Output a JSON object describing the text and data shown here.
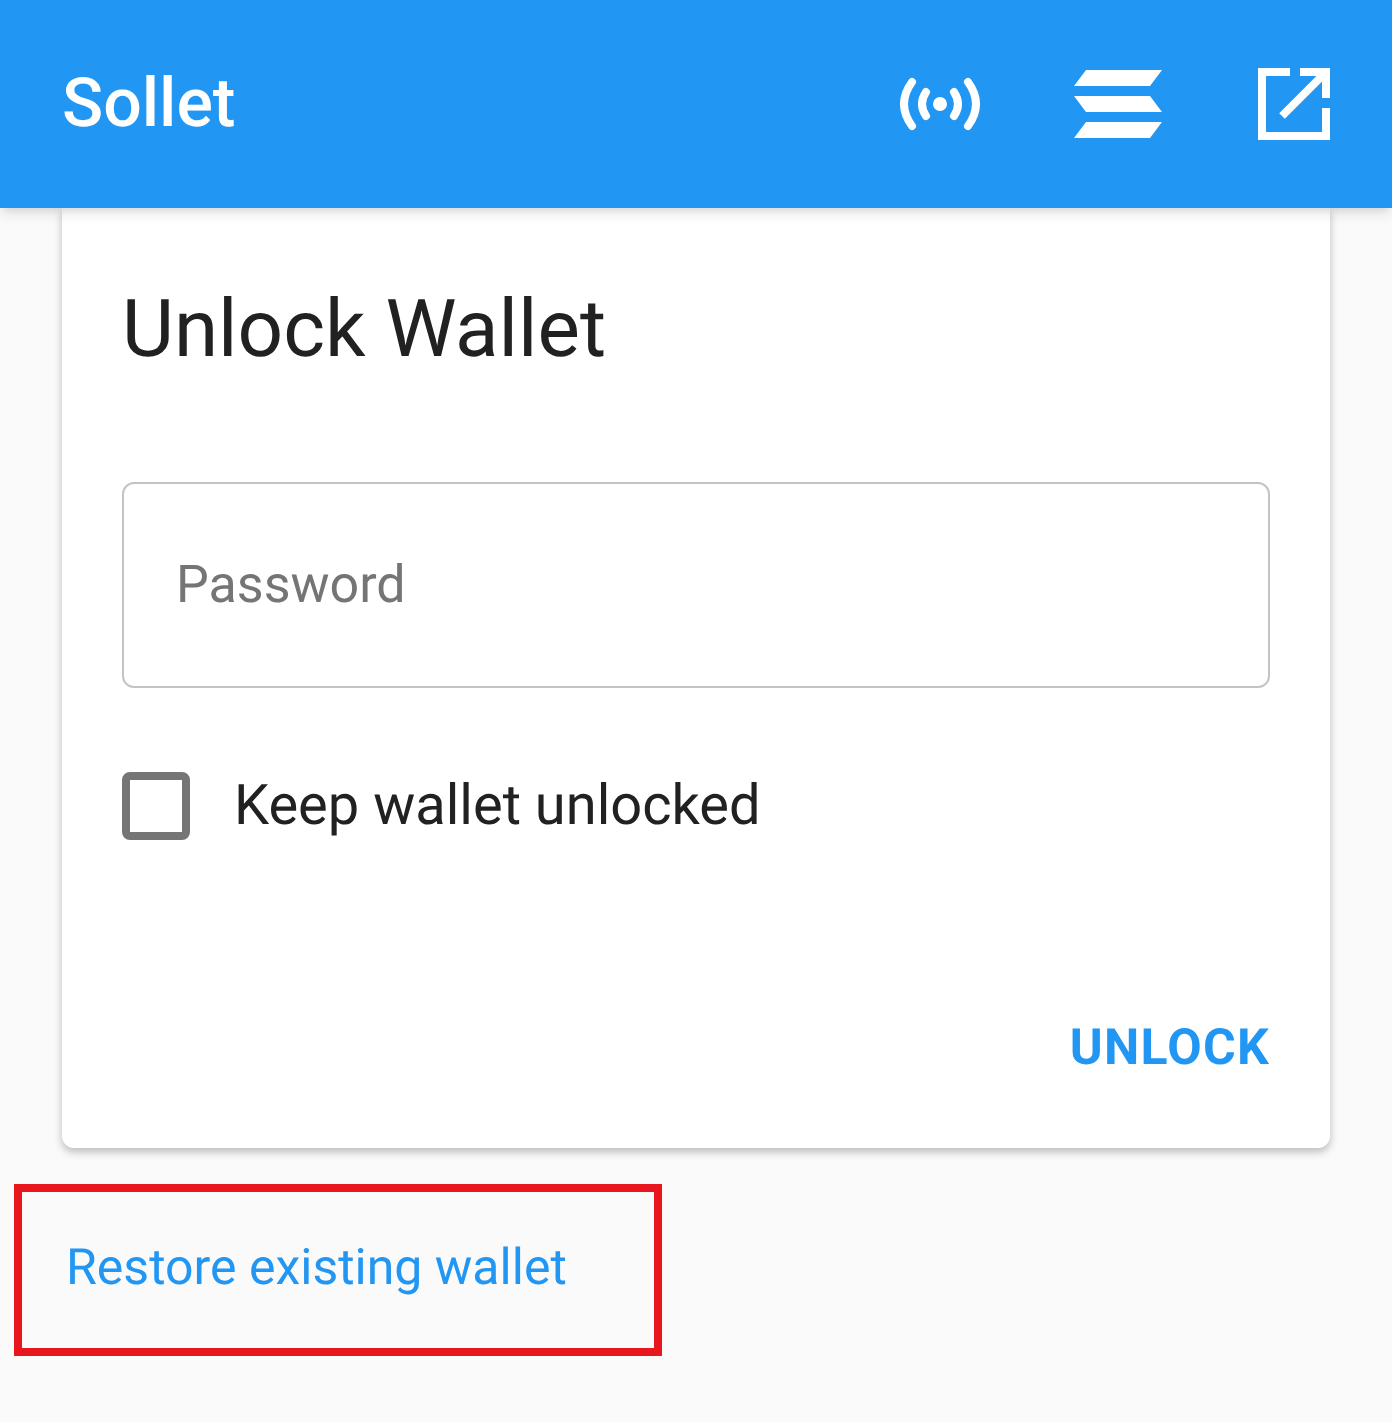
{
  "app_bar": {
    "title": "Sollet"
  },
  "card": {
    "title": "Unlock Wallet",
    "password_field": {
      "placeholder": "Password"
    },
    "keep_unlocked": {
      "label": "Keep wallet unlocked",
      "checked": false
    },
    "unlock_button": "UNLOCK"
  },
  "restore_link": {
    "label": "Restore existing wallet",
    "highlighted": true
  }
}
